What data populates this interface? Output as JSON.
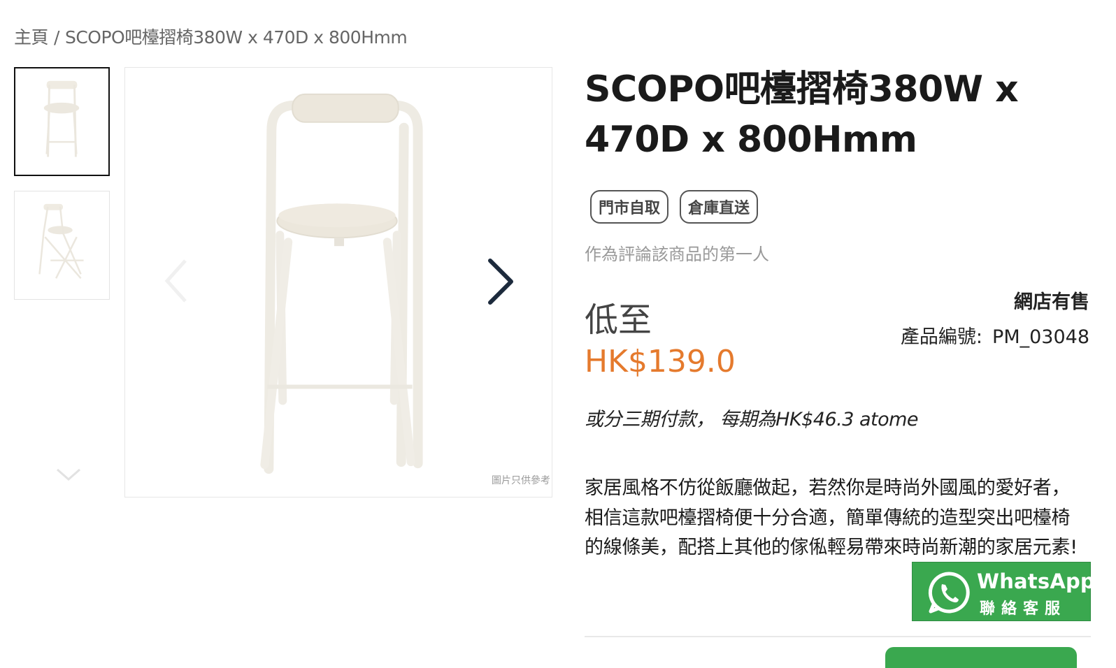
{
  "breadcrumb": {
    "home": "主頁",
    "separator": "/",
    "current": "SCOPO吧檯摺椅380W x 470D x 800Hmm"
  },
  "gallery": {
    "thumbnails": [
      {
        "view": "front",
        "selected": true
      },
      {
        "view": "folded-side",
        "selected": false
      }
    ],
    "watermark": "圖片只供參考",
    "icons": {
      "prev": "chevron-left-icon",
      "next": "chevron-right-icon",
      "thumbs_down": "chevron-down-icon"
    }
  },
  "product": {
    "title": "SCOPO吧檯摺椅380W x 470D x 800Hmm",
    "tags": [
      "門市自取",
      "倉庫直送"
    ],
    "review_link": "作為評論該商品的第一人",
    "price_label": "低至",
    "price": "HK$139.0",
    "installment": "或分三期付款， 每期為HK$46.3 atome",
    "availability": "網店有售",
    "sku_label": "產品編號:",
    "sku_value": "PM_03048",
    "description": "家居風格不仿從飯廳做起，若然你是時尚外國風的愛好者，相信這款吧檯摺椅便十分合適，簡單傳統的造型突出吧檯椅的線條美，配搭上其他的傢俬輕易帶來時尚新潮的家居元素!"
  },
  "whatsapp": {
    "title": "WhatsApp",
    "subtitle": "聯絡客服",
    "icon": "whatsapp-icon"
  },
  "colors": {
    "price": "#e57a2d",
    "whatsapp_green": "#3aa84f",
    "navy_arrow": "#1c2a3c"
  }
}
